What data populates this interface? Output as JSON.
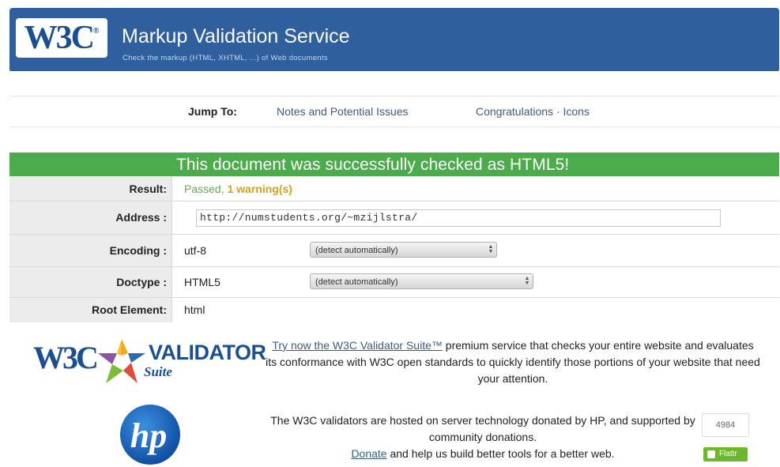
{
  "header": {
    "logo": "W3C",
    "title": "Markup Validation Service",
    "subtitle": "Check the markup (HTML, XHTML, ...) of Web documents"
  },
  "jump": {
    "label": "Jump To:",
    "links": [
      "Notes and Potential Issues",
      "Congratulations · Icons"
    ]
  },
  "result": {
    "banner": "This document was successfully checked as HTML5!",
    "rows": {
      "result": {
        "label": "Result:",
        "passed": "Passed,",
        "warnings": "1 warning(s)"
      },
      "address": {
        "label": "Address :",
        "value": "http://numstudents.org/~mzijlstra/"
      },
      "encoding": {
        "label": "Encoding :",
        "value": "utf-8",
        "select": "(detect automatically)"
      },
      "doctype": {
        "label": "Doctype :",
        "value": "HTML5",
        "select": "(detect automatically)"
      },
      "root": {
        "label": "Root Element:",
        "value": "html"
      }
    }
  },
  "promo": {
    "logo_w3c": "W3C",
    "logo_validator": "VALIDATOR",
    "logo_suite": "Suite",
    "link": "Try now the W3C Validator Suite™",
    "text": " premium service that checks your entire website and evaluates its conformance with W3C open standards to quickly identify those portions of your website that need your attention."
  },
  "hosting": {
    "line1": "The W3C validators are hosted on server technology donated by HP, and supported by community donations.",
    "donate_link": "Donate",
    "line2": " and help us build better tools for a better web.",
    "counter": "4984",
    "flattr_label": "Flattr"
  },
  "colors": {
    "banner": "#2f5f9c",
    "success": "#4cac4c",
    "link": "#3a5d86",
    "warning": "#d4a017"
  }
}
